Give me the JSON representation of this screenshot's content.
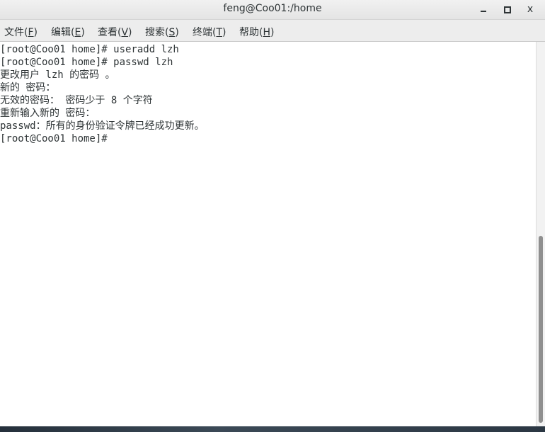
{
  "window": {
    "title": "feng@Coo01:/home",
    "minimize_label": "_",
    "close_label": "x"
  },
  "menubar": {
    "items": [
      {
        "label": "文件(",
        "key": "F",
        "suffix": ")"
      },
      {
        "label": "编辑(",
        "key": "E",
        "suffix": ")"
      },
      {
        "label": "查看(",
        "key": "V",
        "suffix": ")"
      },
      {
        "label": "搜索(",
        "key": "S",
        "suffix": ")"
      },
      {
        "label": "终端(",
        "key": "T",
        "suffix": ")"
      },
      {
        "label": "帮助(",
        "key": "H",
        "suffix": ")"
      }
    ]
  },
  "terminal": {
    "lines": [
      "[root@Coo01 home]# useradd lzh",
      "[root@Coo01 home]# passwd lzh",
      "更改用户 lzh 的密码 。",
      "新的 密码：",
      "无效的密码： 密码少于 8 个字符",
      "重新输入新的 密码：",
      "passwd：所有的身份验证令牌已经成功更新。",
      "[root@Coo01 home]# "
    ]
  },
  "colors": {
    "text": "#2e3436",
    "background": "#ffffff",
    "titlebar": "#e8e8e8",
    "menubar": "#ededed",
    "scroll_thumb": "#8f8f8f"
  }
}
